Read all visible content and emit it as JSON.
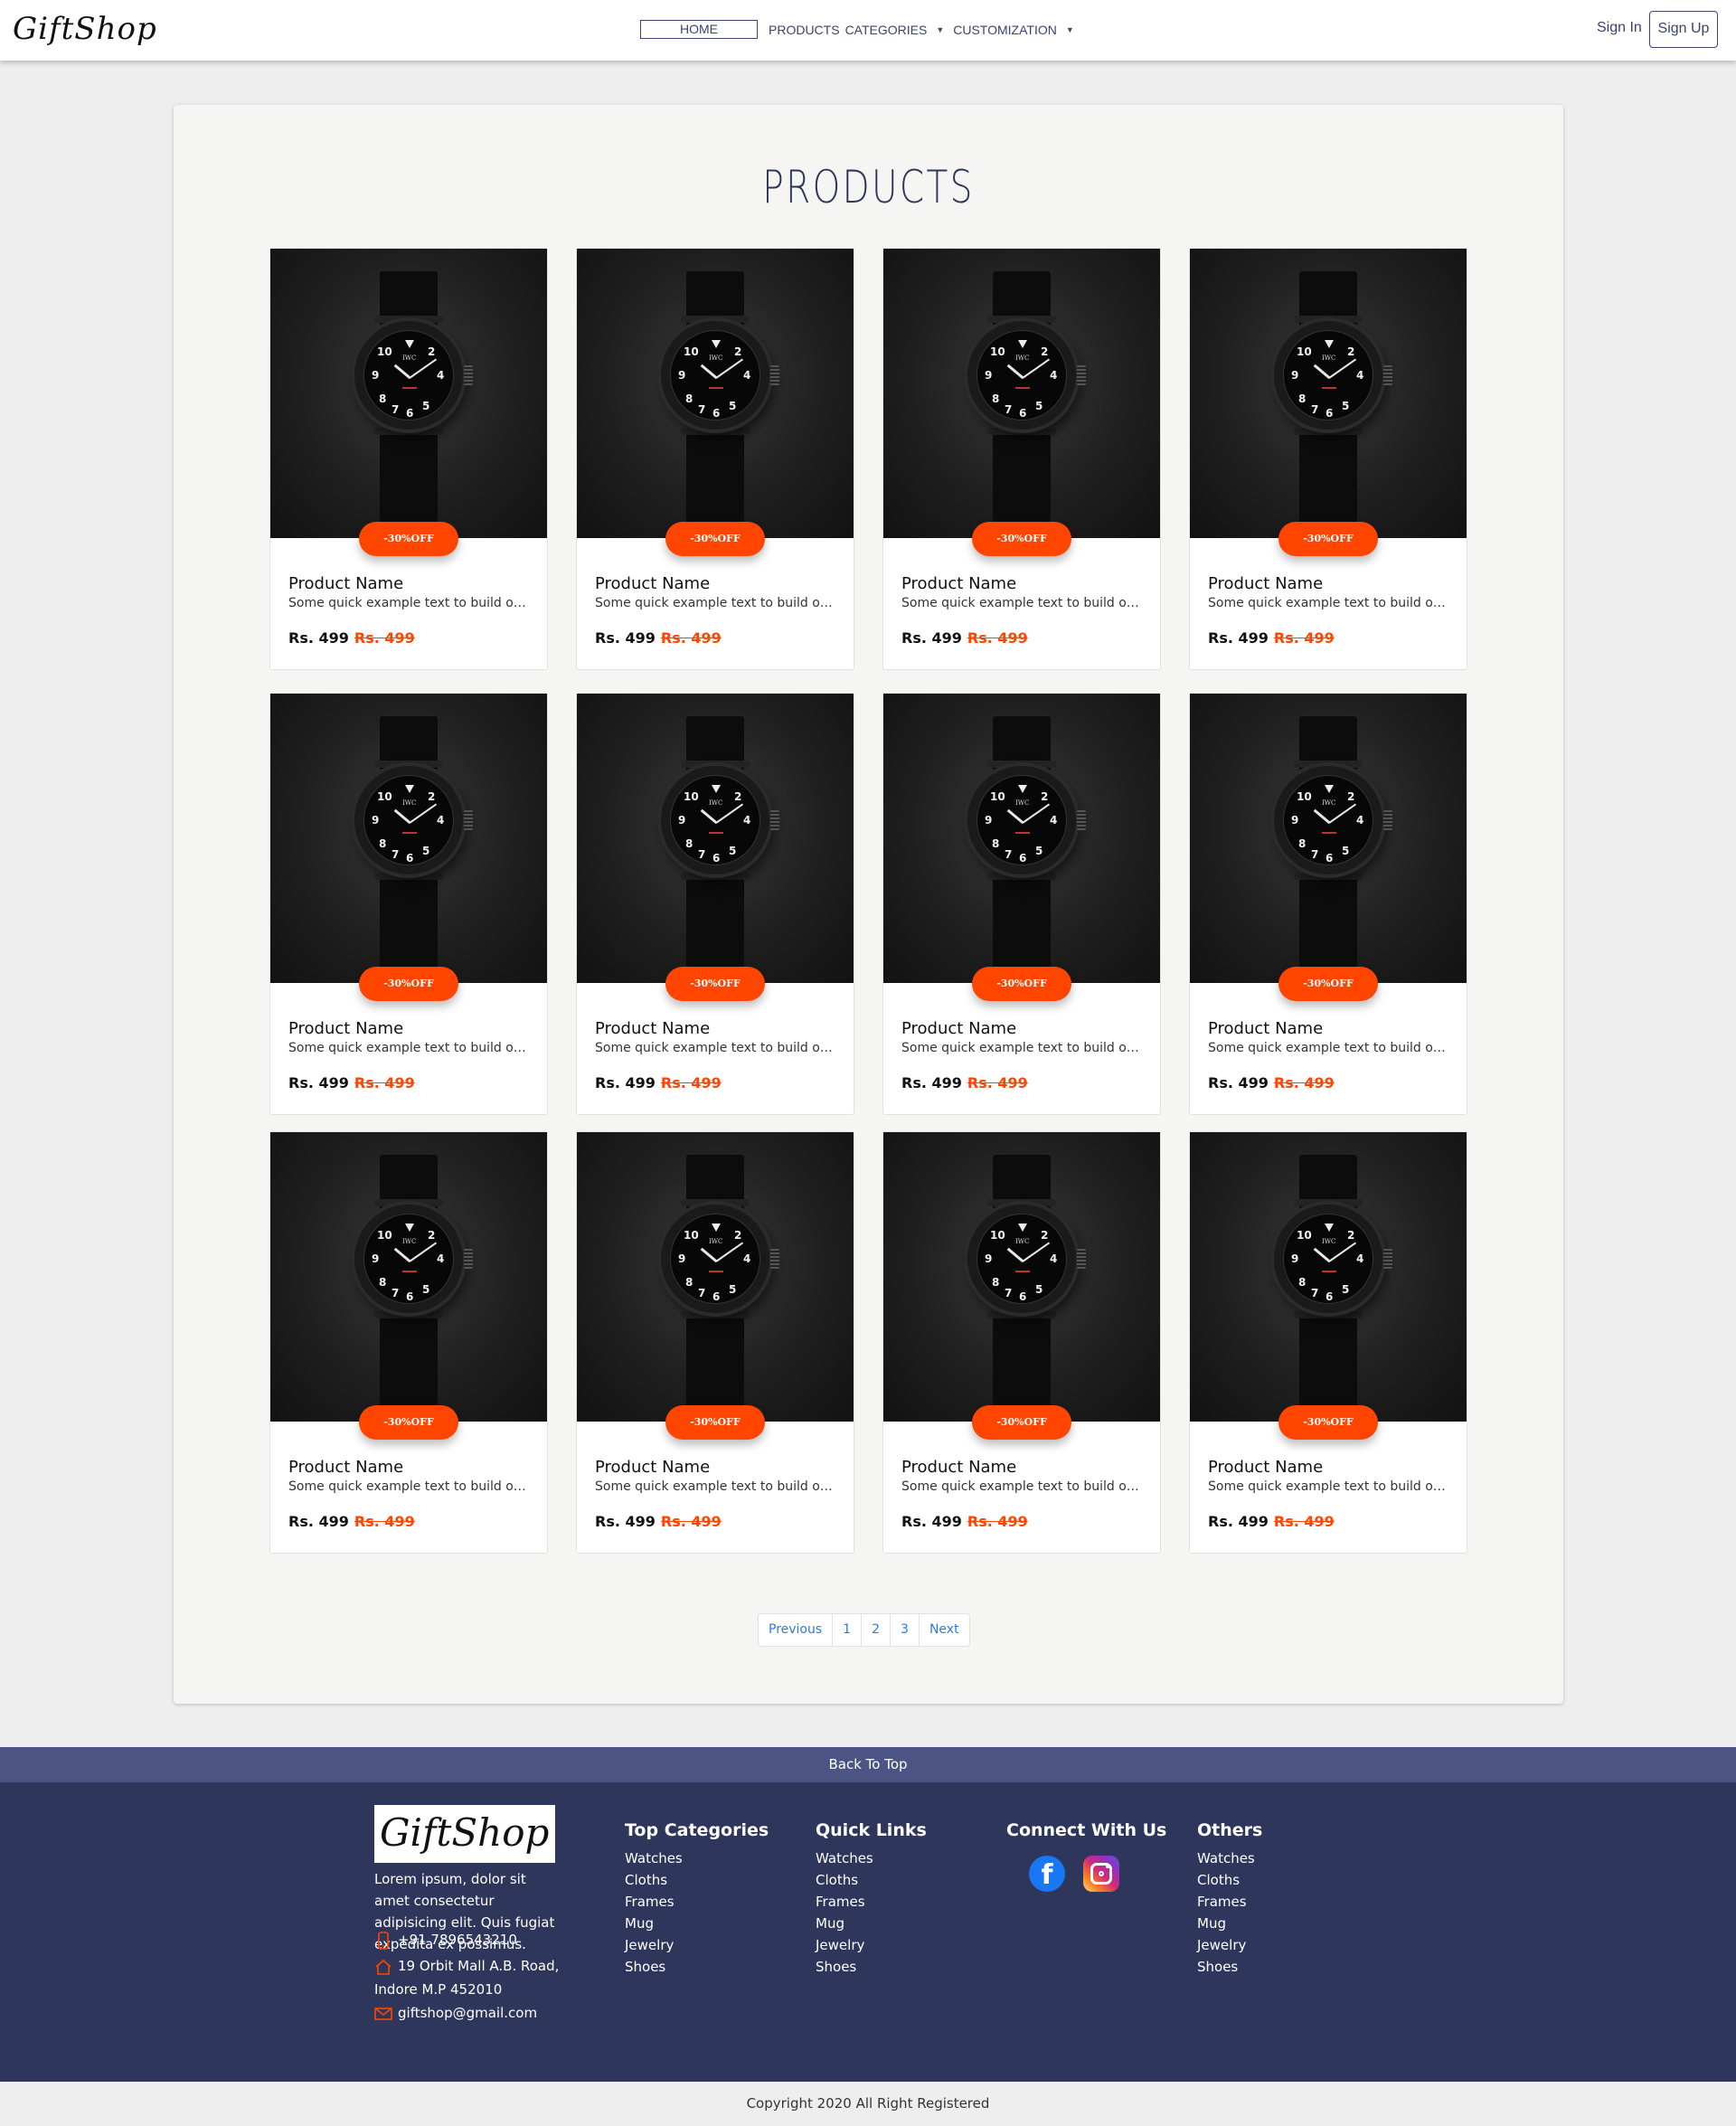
{
  "nav": {
    "logo": "GiftShop",
    "home": "HOME",
    "products": "PRODUCTS",
    "categories": "CATEGORIES",
    "customization": "CUSTOMIZATION",
    "signin": "Sign In",
    "signup": "Sign Up"
  },
  "main": {
    "title": "PRODUCTS",
    "products": [
      {
        "badge": "-30%OFF",
        "name": "Product Name",
        "text": "Some quick example text to build on the card title",
        "price": "Rs. 499",
        "old_price": "Rs. 499"
      },
      {
        "badge": "-30%OFF",
        "name": "Product Name",
        "text": "Some quick example text to build on the card title",
        "price": "Rs. 499",
        "old_price": "Rs. 499"
      },
      {
        "badge": "-30%OFF",
        "name": "Product Name",
        "text": "Some quick example text to build on the card title",
        "price": "Rs. 499",
        "old_price": "Rs. 499"
      },
      {
        "badge": "-30%OFF",
        "name": "Product Name",
        "text": "Some quick example text to build on the card title",
        "price": "Rs. 499",
        "old_price": "Rs. 499"
      },
      {
        "badge": "-30%OFF",
        "name": "Product Name",
        "text": "Some quick example text to build on the card title",
        "price": "Rs. 499",
        "old_price": "Rs. 499"
      },
      {
        "badge": "-30%OFF",
        "name": "Product Name",
        "text": "Some quick example text to build on the card title",
        "price": "Rs. 499",
        "old_price": "Rs. 499"
      },
      {
        "badge": "-30%OFF",
        "name": "Product Name",
        "text": "Some quick example text to build on the card title",
        "price": "Rs. 499",
        "old_price": "Rs. 499"
      },
      {
        "badge": "-30%OFF",
        "name": "Product Name",
        "text": "Some quick example text to build on the card title",
        "price": "Rs. 499",
        "old_price": "Rs. 499"
      },
      {
        "badge": "-30%OFF",
        "name": "Product Name",
        "text": "Some quick example text to build on the card title",
        "price": "Rs. 499",
        "old_price": "Rs. 499"
      },
      {
        "badge": "-30%OFF",
        "name": "Product Name",
        "text": "Some quick example text to build on the card title",
        "price": "Rs. 499",
        "old_price": "Rs. 499"
      },
      {
        "badge": "-30%OFF",
        "name": "Product Name",
        "text": "Some quick example text to build on the card title",
        "price": "Rs. 499",
        "old_price": "Rs. 499"
      },
      {
        "badge": "-30%OFF",
        "name": "Product Name",
        "text": "Some quick example text to build on the card title",
        "price": "Rs. 499",
        "old_price": "Rs. 499"
      }
    ],
    "pagination": [
      "Previous",
      "1",
      "2",
      "3",
      "Next"
    ]
  },
  "footer": {
    "back_to_top": "Back To Top",
    "logo": "GiftShop",
    "about": "Lorem ipsum, dolor sit amet consectetur adipisicing elit. Quis fugiat expedita ex possimus.",
    "phone": "+91 7896543210",
    "address_line1": "19 Orbit Mall A.B. Road,",
    "address_line2": "Indore M.P 452010",
    "email": "giftshop@gmail.com",
    "columns": [
      {
        "title": "Top Categories",
        "items": [
          "Watches",
          "Cloths",
          "Frames",
          "Mug",
          "Jewelry",
          "Shoes"
        ]
      },
      {
        "title": "Quick Links",
        "items": [
          "Watches",
          "Cloths",
          "Frames",
          "Mug",
          "Jewelry",
          "Shoes"
        ]
      },
      {
        "title": "Connect With Us",
        "items": []
      },
      {
        "title": "Others",
        "items": [
          "Watches",
          "Cloths",
          "Frames",
          "Mug",
          "Jewelry",
          "Shoes"
        ]
      }
    ],
    "social": [
      "facebook-icon",
      "instagram-icon"
    ],
    "copyright": "Copyright 2020 All Right Registered"
  },
  "colors": {
    "accent": "#ff4500",
    "nav_text": "#3b4370",
    "footer_bg": "#2f365c",
    "back_top_bg": "#4b5483",
    "link": "#2b7be4"
  }
}
